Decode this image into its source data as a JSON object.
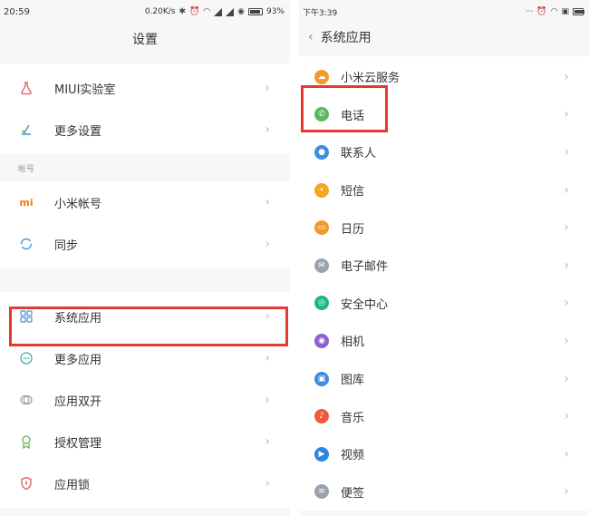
{
  "left": {
    "status": {
      "time": "20:59",
      "speed": "0.20K/s",
      "battery": "93%"
    },
    "title": "设置",
    "group1": [
      {
        "label": "MIUI实验室",
        "icon": "flask-icon"
      },
      {
        "label": "更多设置",
        "icon": "more-settings-icon"
      }
    ],
    "section_label": "帐号",
    "group2": [
      {
        "label": "小米帐号",
        "icon": "mi-logo-icon"
      },
      {
        "label": "同步",
        "icon": "sync-icon"
      }
    ],
    "group3": [
      {
        "label": "系统应用",
        "icon": "system-apps-icon"
      },
      {
        "label": "更多应用",
        "icon": "more-apps-icon"
      },
      {
        "label": "应用双开",
        "icon": "dual-apps-icon"
      },
      {
        "label": "授权管理",
        "icon": "permissions-icon"
      },
      {
        "label": "应用锁",
        "icon": "app-lock-icon"
      }
    ]
  },
  "right": {
    "status": {
      "time": "下午3:39"
    },
    "title": "系统应用",
    "items": [
      {
        "label": "小米云服务",
        "icon": "cloud-icon",
        "color": "#f39a2b"
      },
      {
        "label": "电话",
        "icon": "phone-icon",
        "color": "#5cb85c"
      },
      {
        "label": "联系人",
        "icon": "contacts-icon",
        "color": "#3b8de0"
      },
      {
        "label": "短信",
        "icon": "messages-icon",
        "color": "#f5a623"
      },
      {
        "label": "日历",
        "icon": "calendar-icon",
        "color": "#f39a2b"
      },
      {
        "label": "电子邮件",
        "icon": "email-icon",
        "color": "#9aa3ad"
      },
      {
        "label": "安全中心",
        "icon": "security-icon",
        "color": "#1fb58a"
      },
      {
        "label": "相机",
        "icon": "camera-icon",
        "color": "#8e5fd1"
      },
      {
        "label": "图库",
        "icon": "gallery-icon",
        "color": "#3b8de0"
      },
      {
        "label": "音乐",
        "icon": "music-icon",
        "color": "#ee5a3e"
      },
      {
        "label": "视频",
        "icon": "video-icon",
        "color": "#2e86de"
      },
      {
        "label": "便签",
        "icon": "notes-icon",
        "color": "#9aa3ad"
      }
    ]
  },
  "colors": {
    "highlight": "#e23a2f"
  }
}
